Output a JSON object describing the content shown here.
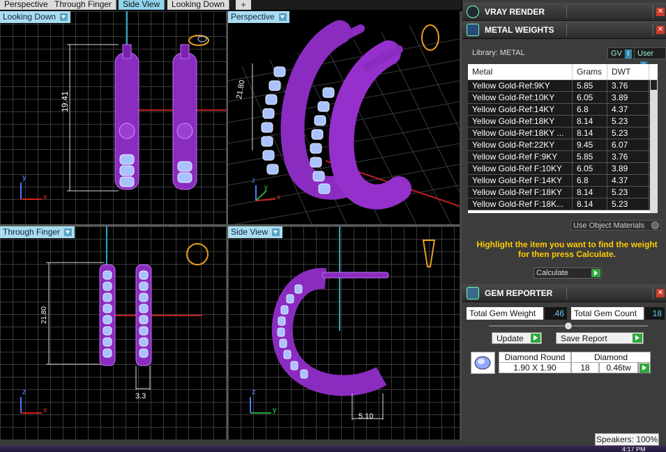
{
  "tabs": [
    "Perspective",
    "Through Finger",
    "Side View",
    "Looking Down"
  ],
  "tab_add": "+",
  "viewports": {
    "top_left": {
      "label": "Looking Down",
      "dimension": "19.41",
      "axis_a": "y",
      "axis_b": "x"
    },
    "top_right": {
      "label": "Perspective",
      "dimension": "21.80",
      "axis_a": "z",
      "axis_b": "x",
      "axis_c": "y"
    },
    "bottom_left": {
      "label": "Through Finger",
      "dimension": "21.80",
      "dimension2": "3.3",
      "axis_a": "z",
      "axis_b": "x"
    },
    "bottom_right": {
      "label": "Side View",
      "dimension": "5.10",
      "axis_a": "z",
      "axis_b": "y"
    }
  },
  "panel": {
    "vray": {
      "title": "VRAY RENDER"
    },
    "metal": {
      "title": "METAL WEIGHTS",
      "library_label": "Library: METAL",
      "gv_label": "GV",
      "user_label": "User",
      "columns": [
        "Metal",
        "Grams",
        "DWT"
      ],
      "rows": [
        [
          "Yellow Gold-Ref:9KY",
          "5.85",
          "3.76"
        ],
        [
          "Yellow Gold-Ref:10KY",
          "6.05",
          "3.89"
        ],
        [
          "Yellow Gold-Ref:14KY",
          "6.8",
          "4.37"
        ],
        [
          "Yellow Gold-Ref:18KY",
          "8.14",
          "5.23"
        ],
        [
          "Yellow Gold-Ref:18KY ...",
          "8.14",
          "5.23"
        ],
        [
          "Yellow Gold-Ref:22KY",
          "9.45",
          "6.07"
        ],
        [
          "Yellow Gold-Ref F:9KY",
          "5.85",
          "3.76"
        ],
        [
          "Yellow Gold-Ref F:10KY",
          "6.05",
          "3.89"
        ],
        [
          "Yellow Gold-Ref F:14KY",
          "6.8",
          "4.37"
        ],
        [
          "Yellow Gold-Ref F:18KY",
          "8.14",
          "5.23"
        ],
        [
          "Yellow Gold-Ref F:18K...",
          "8.14",
          "5.23"
        ]
      ],
      "use_object_materials": "Use Object Materials",
      "hint": "Highlight the item you want to find the weight for then press Calculate.",
      "calculate": "Calculate"
    },
    "gem": {
      "title": "GEM REPORTER",
      "total_weight_label": "Total Gem Weight",
      "total_weight_value": ".46",
      "total_count_label": "Total Gem Count",
      "total_count_value": "18",
      "update": "Update",
      "save_report": "Save Report",
      "item": {
        "shape": "Diamond Round",
        "size": "1.90 X 1.90",
        "material": "Diamond",
        "count": "18",
        "weight": "0.46tw"
      }
    }
  },
  "tray": {
    "speakers": "Speakers: 100%",
    "clock": "4:17 PM"
  },
  "colors": {
    "accent": "#8fd3ec",
    "model": "#8a2cc0",
    "stones": "#9fb8ff",
    "panel": "#3c3c3c",
    "hint": "#ffcc00"
  }
}
